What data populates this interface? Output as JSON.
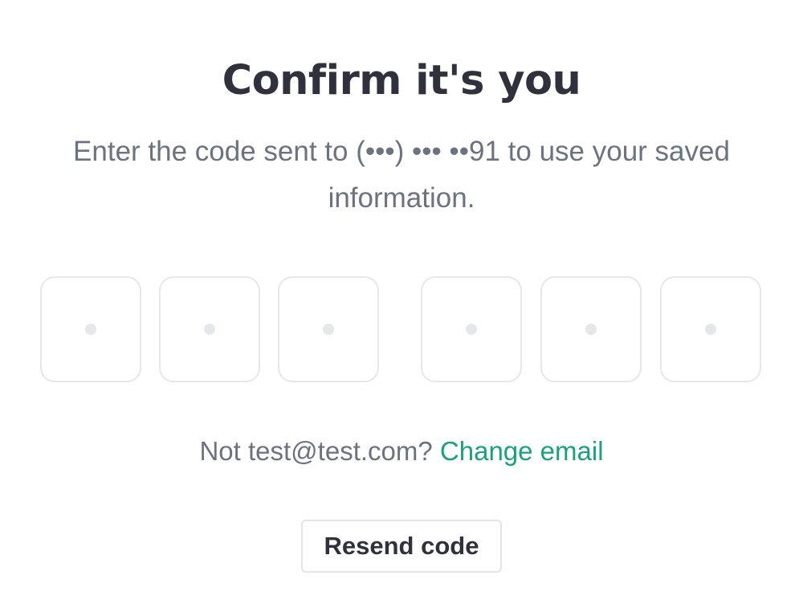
{
  "header": {
    "title": "Confirm it's you",
    "subtitle": "Enter the code sent to (•••) ••• ••91 to use your saved information."
  },
  "code_input": {
    "digits": [
      "",
      "",
      "",
      "",
      "",
      ""
    ],
    "placeholder_glyph": "dot"
  },
  "account": {
    "prompt": "Not test@test.com?",
    "change_label": "Change email"
  },
  "actions": {
    "resend_label": "Resend code"
  },
  "colors": {
    "title": "#30313d",
    "body_text": "#6b7280",
    "link": "#1aa37a",
    "border": "#e6e7eb"
  }
}
